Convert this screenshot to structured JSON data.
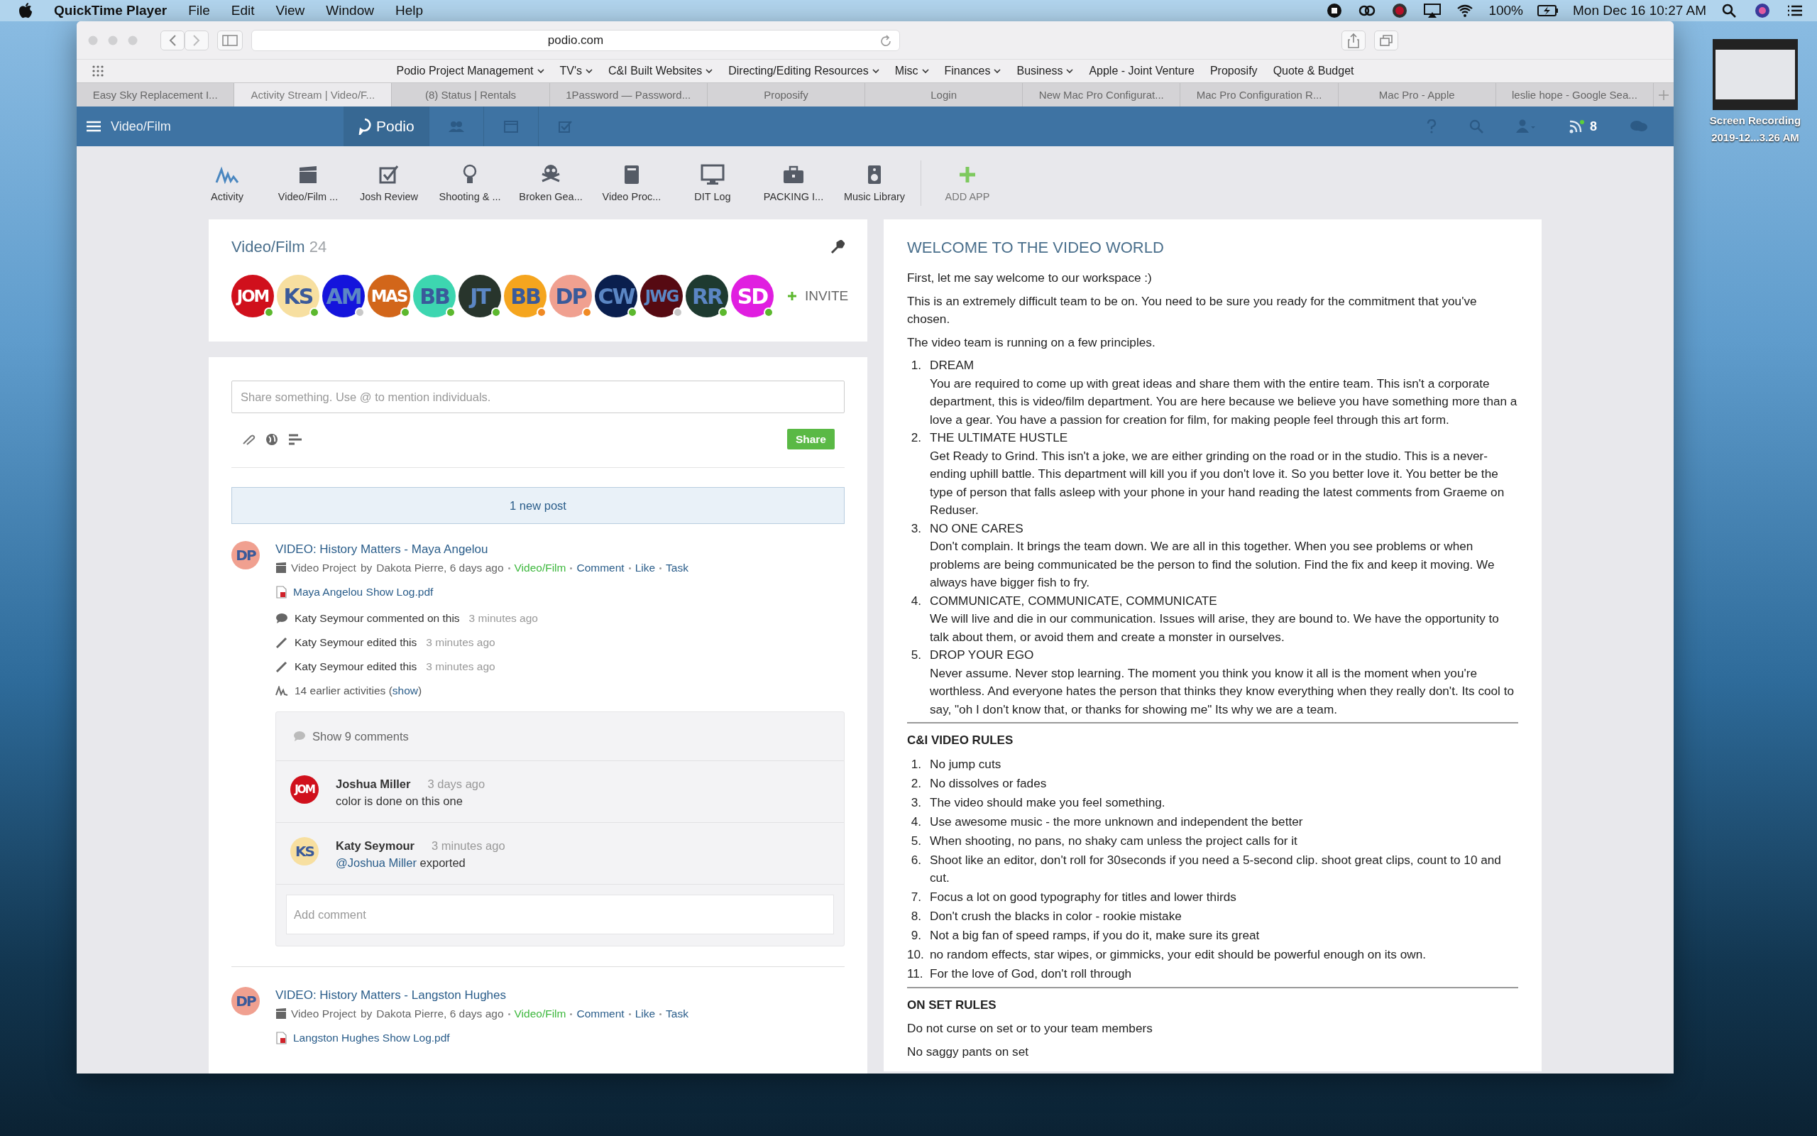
{
  "menu_bar": {
    "app": "QuickTime Player",
    "menus": [
      "File",
      "Edit",
      "View",
      "Window",
      "Help"
    ],
    "battery": "100%",
    "clock": "Mon Dec 16  10:27 AM"
  },
  "browser": {
    "address": "podio.com",
    "bookmarks": [
      {
        "label": "Podio Project Management",
        "dropdown": true
      },
      {
        "label": "TV's",
        "dropdown": true
      },
      {
        "label": "C&I Built Websites",
        "dropdown": true
      },
      {
        "label": "Directing/Editing Resources",
        "dropdown": true
      },
      {
        "label": "Misc",
        "dropdown": true
      },
      {
        "label": "Finances",
        "dropdown": true
      },
      {
        "label": "Business",
        "dropdown": true
      },
      {
        "label": "Apple - Joint Venture",
        "dropdown": false
      },
      {
        "label": "Proposify",
        "dropdown": false
      },
      {
        "label": "Quote & Budget",
        "dropdown": false
      }
    ],
    "tabs": [
      {
        "label": "Easy Sky Replacement I...",
        "selected": false
      },
      {
        "label": "Activity Stream | Video/F...",
        "selected": true
      },
      {
        "label": "(8) Status | Rentals",
        "selected": false
      },
      {
        "label": "1Password — Password...",
        "selected": false
      },
      {
        "label": "Proposify",
        "selected": false
      },
      {
        "label": "Login",
        "selected": false
      },
      {
        "label": "New Mac Pro Configurat...",
        "selected": false
      },
      {
        "label": "Mac Pro Configuration R...",
        "selected": false
      },
      {
        "label": "Mac Pro - Apple",
        "selected": false
      },
      {
        "label": "leslie hope - Google Sea...",
        "selected": false
      }
    ]
  },
  "podio_header": {
    "workspace": "Video/Film",
    "logo": "Podio",
    "notifications": "8"
  },
  "apps": [
    {
      "label": "Activity",
      "kind": "activity"
    },
    {
      "label": "Video/Film ...",
      "kind": "clapper"
    },
    {
      "label": "Josh Review",
      "kind": "checkbox"
    },
    {
      "label": "Shooting & ...",
      "kind": "bulb"
    },
    {
      "label": "Broken Gea...",
      "kind": "skull"
    },
    {
      "label": "Video Proc...",
      "kind": "book"
    },
    {
      "label": "DIT Log",
      "kind": "monitor"
    },
    {
      "label": "PACKING I...",
      "kind": "briefcase"
    },
    {
      "label": "Music Library",
      "kind": "speaker"
    }
  ],
  "add_app": "ADD APP",
  "workspace_card": {
    "title": "Video/Film",
    "count": "24",
    "invite": "INVITE",
    "members": [
      {
        "initials": "JOM",
        "color": "#d0101c",
        "status_dot": {
          "color": "#5cb82e"
        }
      },
      {
        "initials": "KS",
        "color": "#f7dfa0",
        "status_dot": {
          "color": "#5cb82e"
        }
      },
      {
        "initials": "AM",
        "color": "#1414dc",
        "status_dot": {
          "color": "#c8c8c8"
        }
      },
      {
        "initials": "MAS",
        "color": "#d2661a",
        "status_dot": {
          "color": "#5cb82e"
        }
      },
      {
        "initials": "BB",
        "color": "#3dd6b0",
        "status_dot": {
          "color": "#5cb82e"
        }
      },
      {
        "initials": "JT",
        "color": "#28352c",
        "status_dot": {
          "color": "#5cb82e"
        }
      },
      {
        "initials": "BB",
        "color": "#f5a51e",
        "status_dot": {
          "color": "#f08a24"
        }
      },
      {
        "initials": "DP",
        "color": "#f0a090",
        "status_dot": {
          "color": "#f08a24"
        }
      },
      {
        "initials": "CW",
        "color": "#0a1f4e",
        "status_dot": {
          "color": "#5cb82e"
        }
      },
      {
        "initials": "JWG",
        "color": "#560a12",
        "status_dot": {
          "color": "#c8c8c8"
        }
      },
      {
        "initials": "RR",
        "color": "#1e3a30",
        "status_dot": {
          "color": "#5cb82e"
        }
      },
      {
        "initials": "SD",
        "color": "#e01ee0",
        "status_dot": {
          "color": "#5cb82e"
        }
      }
    ]
  },
  "share_box": {
    "placeholder": "Share something. Use @ to mention individuals.",
    "button": "Share"
  },
  "new_posts": "1 new post",
  "posts": [
    {
      "avatar": {
        "initials": "DP",
        "color": "#f0a090"
      },
      "title": "VIDEO: History Matters - Maya Angelou",
      "type": "Video Project",
      "by": "by",
      "author": "Dakota Pierre, 6 days ago",
      "space": "Video/Film",
      "actions": [
        "Comment",
        "Like",
        "Task"
      ],
      "file": "Maya Angelou Show Log.pdf",
      "activities": [
        {
          "kind": "comment",
          "text": "Katy Seymour commented on this",
          "time": "3 minutes ago"
        },
        {
          "kind": "edit",
          "text": "Katy Seymour edited this",
          "time": "3 minutes ago"
        },
        {
          "kind": "edit",
          "text": "Katy Seymour edited this",
          "time": "3 minutes ago"
        }
      ],
      "earlier": {
        "before": "14 earlier activities (",
        "link": "show",
        "after": ")"
      },
      "show_comments": "Show 9 comments",
      "comments": [
        {
          "avatar": {
            "initials": "JOM",
            "color": "#d0101c"
          },
          "author": "Joshua Miller",
          "time": "3 days ago",
          "text": "color is done on this one"
        },
        {
          "avatar": {
            "initials": "KS",
            "color": "#f7dfa0"
          },
          "author": "Katy Seymour",
          "time": "3 minutes ago",
          "mention": "@Joshua Miller",
          "text": "exported"
        }
      ],
      "comment_placeholder": "Add comment"
    },
    {
      "avatar": {
        "initials": "DP",
        "color": "#f0a090"
      },
      "title": "VIDEO: History Matters - Langston Hughes",
      "type": "Video Project",
      "by": "by",
      "author": "Dakota Pierre, 6 days ago",
      "space": "Video/Film",
      "actions": [
        "Comment",
        "Like",
        "Task"
      ],
      "file": "Langston Hughes Show Log.pdf"
    }
  ],
  "welcome": {
    "title": "WELCOME TO THE VIDEO WORLD",
    "intro": [
      "First, let me say welcome to our workspace :)",
      "This is an extremely difficult team to be on. You need to be sure you ready for the commitment that you've chosen.",
      "The video team is running on a few principles."
    ],
    "principles": [
      {
        "number": "1.",
        "title": "DREAM",
        "body": "You are required to come up with great ideas and share them with the entire team. This isn't a corporate department, this is video/film department. You are here because we believe you have something more than a love a gear. You have a passion for creation for film, for making people feel through this art form."
      },
      {
        "number": "2.",
        "title": "THE ULTIMATE HUSTLE",
        "body": "Get Ready to Grind. This isn't a joke, we are either grinding on the road or in the studio. This is a never-ending uphill battle. This department will kill you if you don't love it. So you better love it. You better be the type of person that falls asleep with your phone in your hand reading the latest comments from Graeme on Reduser."
      },
      {
        "number": "3.",
        "title": "NO ONE CARES",
        "body": "Don't complain. It brings the team down. We are all in this together. When you see problems or when problems are being communicated be the person to find the solution. Find the fix and keep it moving. We always have bigger fish to fry."
      },
      {
        "number": "4.",
        "title": "COMMUNICATE, COMMUNICATE, COMMUNICATE",
        "body": "We will live and die in our communication. Issues will arise, they are bound to. We have the opportunity to talk about them, or avoid them and create a monster in ourselves."
      },
      {
        "number": "5.",
        "title": "DROP YOUR EGO",
        "body": "Never assume. Never stop learning. The moment you think you know it all is the moment when you're worthless. And everyone hates the person that thinks they know everything when they really don't. Its cool to say, \"oh I don't know that, or thanks for showing me\" Its why we are a team."
      }
    ],
    "rules_title": "C&I VIDEO RULES",
    "rules": [
      {
        "number": "1.",
        "text": "No jump cuts"
      },
      {
        "number": "2.",
        "text": "No dissolves or fades"
      },
      {
        "number": "3.",
        "text": "The video should make you feel something."
      },
      {
        "number": "4.",
        "text": "Use awesome music - the more unknown and independent the better"
      },
      {
        "number": "5.",
        "text": "When shooting, no pans, no shaky cam unless the project calls for it"
      },
      {
        "number": "6.",
        "text": "Shoot like an editor, don't roll for 30seconds if you need a 5-second clip. shoot great clips, count to 10 and cut."
      },
      {
        "number": "7.",
        "text": "Focus a lot on good typography for titles and lower thirds"
      },
      {
        "number": "8.",
        "text": "Don't crush the blacks in color - rookie mistake"
      },
      {
        "number": "9.",
        "text": "Not a big fan of speed ramps, if you do it, make sure its great"
      },
      {
        "number": "10.",
        "text": "no random effects, star wipes, or gimmicks, your edit should be powerful enough on its own."
      },
      {
        "number": "11.",
        "text": "For the love of God, don't roll through"
      }
    ],
    "on_set_title": "ON SET RULES",
    "on_set": [
      "Do not curse on set or to your team members",
      "No saggy pants on set"
    ]
  },
  "desktop": {
    "recording_label": "Screen Recording",
    "recording_date": "2019-12...3.26 AM"
  }
}
